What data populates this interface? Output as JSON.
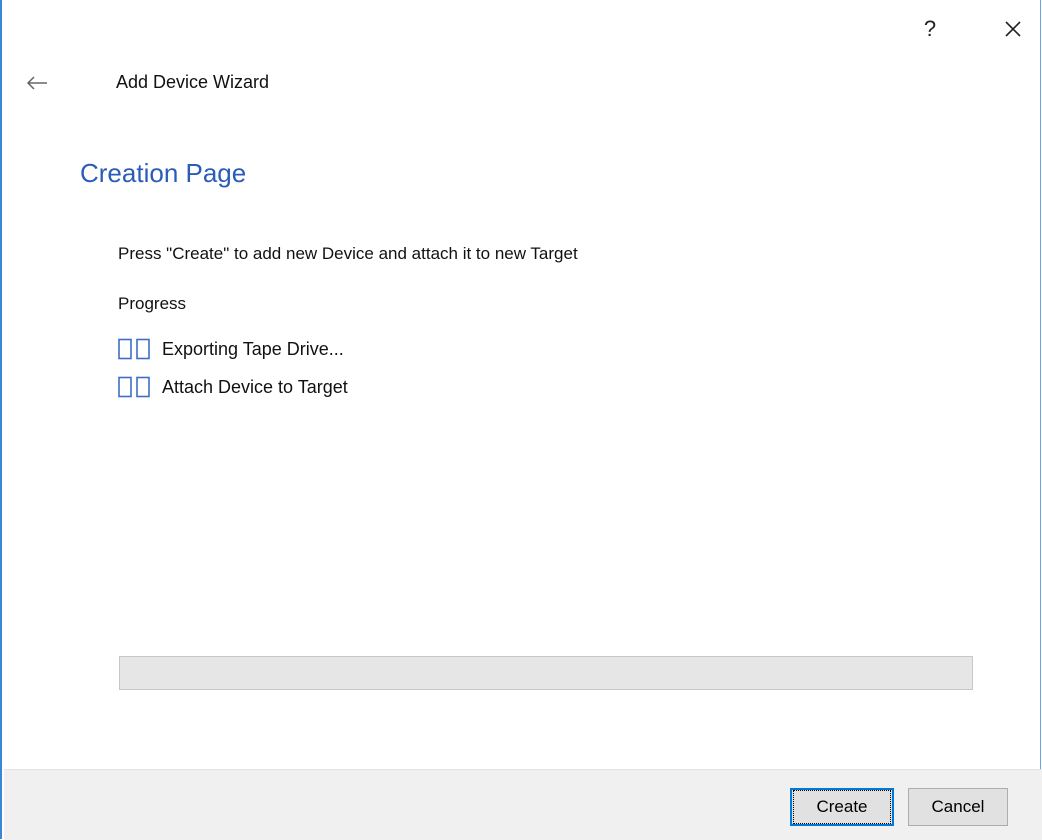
{
  "window": {
    "help_label": "?",
    "title": "Add Device Wizard"
  },
  "icons": {
    "help": "question-mark",
    "close": "close-x",
    "back": "left-arrow",
    "step": "pending-step"
  },
  "page": {
    "heading": "Creation Page",
    "instruction": "Press \"Create\" to add new Device and attach it to new Target",
    "progress_label": "Progress",
    "steps": [
      {
        "label": "Exporting Tape Drive..."
      },
      {
        "label": "Attach Device to Target"
      }
    ],
    "progress_value": 0
  },
  "footer": {
    "create_label": "Create",
    "cancel_label": "Cancel"
  },
  "colors": {
    "accent": "#2b5cb8",
    "window_border": "#3a87d8",
    "step_icon": "#3f6ec4",
    "footer_bg": "#f0f0f0"
  }
}
